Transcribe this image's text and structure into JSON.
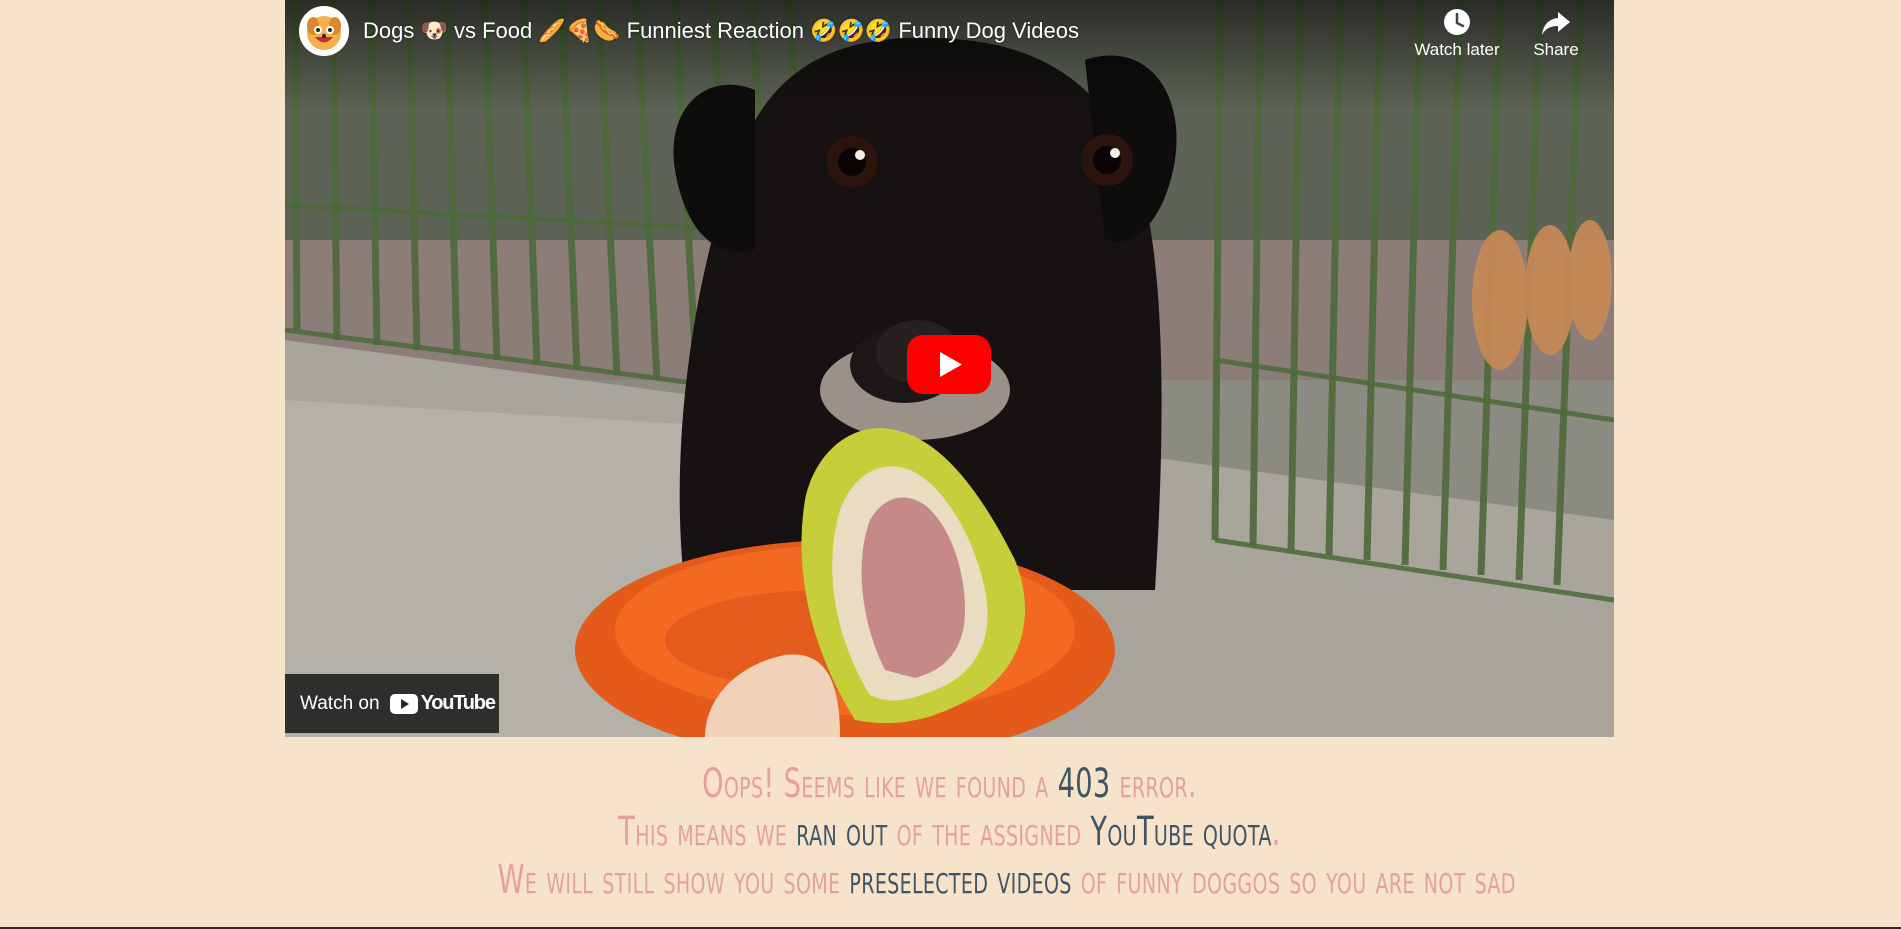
{
  "player": {
    "title": "Dogs 🐶 vs Food 🥖🍕🌭 Funniest Reaction 🤣🤣🤣 Funny Dog Videos",
    "watch_later_label": "Watch later",
    "share_label": "Share",
    "watch_on_label": "Watch on",
    "youtube_logo_text": "YouTube",
    "brand_red": "#ff0000"
  },
  "message": {
    "line1": {
      "before": "Oops! Seems like we found a ",
      "highlight": "403",
      "after": " error."
    },
    "line2": {
      "before": "This means we ",
      "highlight1": "ran out",
      "middle": " of the assigned ",
      "highlight2": "YouTube quota",
      "after": "."
    },
    "line3": {
      "before": "We will still show you some ",
      "highlight": "preselected videos",
      "after": " of funny doggos so you are not sad"
    },
    "colors": {
      "text": "#e4a0a0",
      "highlight": "#3d5568",
      "background": "#f6e3ca"
    }
  }
}
